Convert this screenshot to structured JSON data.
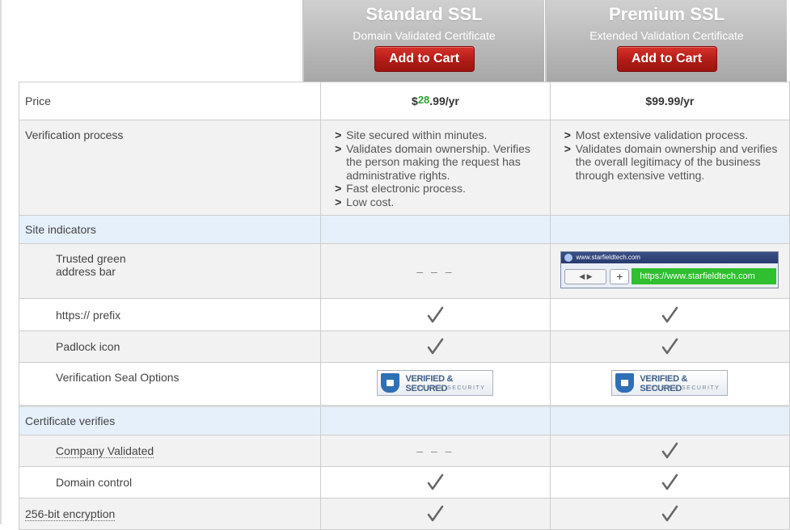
{
  "plans": [
    {
      "name": "Standard SSL",
      "subtitle": "Domain Validated Certificate",
      "cta": "Add to Cart",
      "price_currency": "$",
      "price_dollars": "28",
      "price_rest": ".99/yr"
    },
    {
      "name": "Premium SSL",
      "subtitle": "Extended Validation Certificate",
      "cta": "Add to Cart",
      "price_full": "$99.99/yr"
    }
  ],
  "rows": {
    "price": "Price",
    "verification": "Verification process",
    "site_indicators": "Site indicators",
    "green_bar": "Trusted green address bar",
    "https": "https:// prefix",
    "padlock": "Padlock icon",
    "seal": "Verification Seal Options",
    "cert_verifies": "Certificate verifies",
    "company": "Company Validated",
    "domain": "Domain control",
    "encryption": "256-bit encryption"
  },
  "standard_points": [
    "Site secured within minutes.",
    "Validates domain ownership. Verifies the person making the request has administrative rights.",
    "Fast electronic process.",
    "Low cost."
  ],
  "premium_points": [
    "Most extensive validation process.",
    "Validates domain ownership and verifies the overall legitimacy of the business through extensive vetting."
  ],
  "bullet": ">",
  "dash": "– – –",
  "browser": {
    "title": "www.starfieldtech.com",
    "nav": "◀ ▶",
    "plus": "+",
    "url": "https://www.starfieldtech.com"
  },
  "seal_badge": {
    "line1": "VERIFIED & SECURED",
    "line2": "VERIFY SECURITY"
  },
  "colors": {
    "cta_red": "#b11c17",
    "section_blue": "#e6f0fb",
    "price_green": "#2f9e2f"
  }
}
